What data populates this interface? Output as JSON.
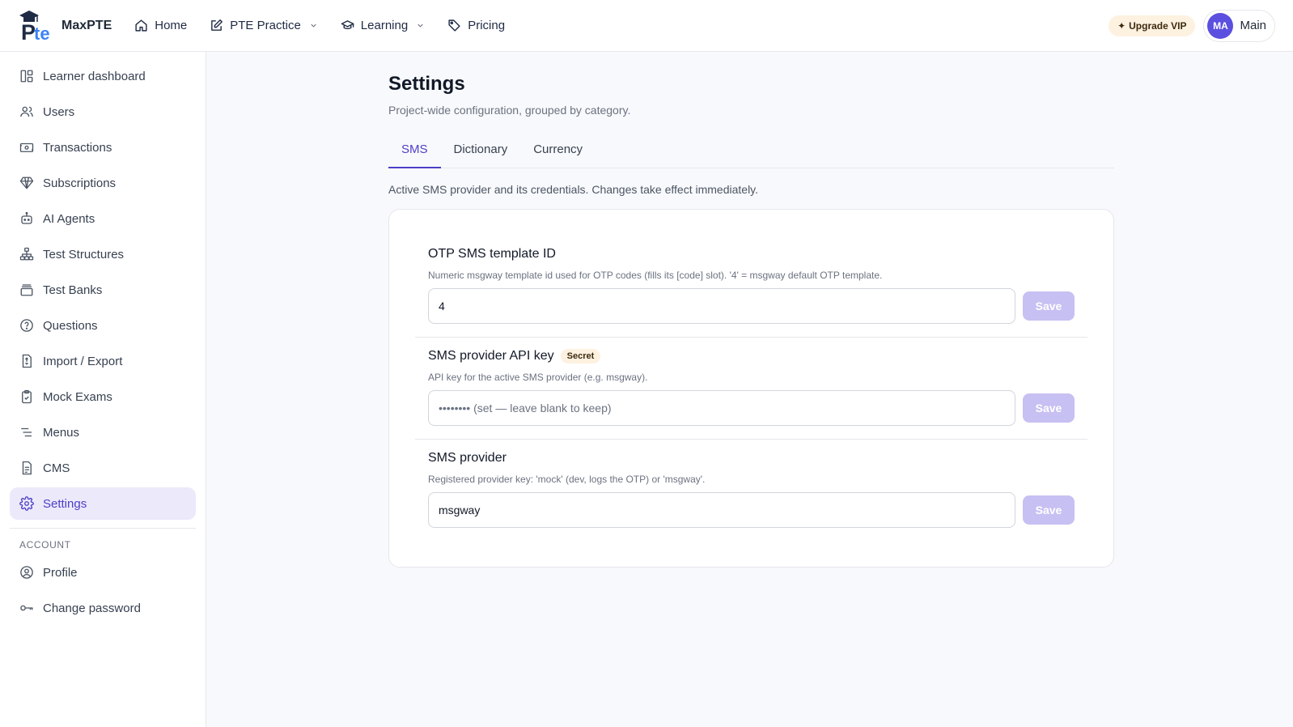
{
  "brand": {
    "name": "MaxPTE"
  },
  "nav": {
    "items": [
      {
        "label": "Home",
        "icon": "home-icon"
      },
      {
        "label": "PTE Practice",
        "icon": "pencil-square-icon",
        "has_dropdown": true
      },
      {
        "label": "Learning",
        "icon": "graduation-cap-icon",
        "has_dropdown": true
      },
      {
        "label": "Pricing",
        "icon": "tag-icon"
      }
    ]
  },
  "header": {
    "vip_label": "Upgrade VIP",
    "user_initials": "MA",
    "user_name": "Main"
  },
  "sidebar": {
    "items": [
      {
        "label": "Learner dashboard",
        "icon": "dashboard-icon"
      },
      {
        "label": "Users",
        "icon": "users-icon"
      },
      {
        "label": "Transactions",
        "icon": "banknote-icon"
      },
      {
        "label": "Subscriptions",
        "icon": "gem-icon"
      },
      {
        "label": "AI Agents",
        "icon": "bot-icon"
      },
      {
        "label": "Test Structures",
        "icon": "hierarchy-icon"
      },
      {
        "label": "Test Banks",
        "icon": "archive-icon"
      },
      {
        "label": "Questions",
        "icon": "question-circle-icon"
      },
      {
        "label": "Import / Export",
        "icon": "file-transfer-icon"
      },
      {
        "label": "Mock Exams",
        "icon": "clipboard-check-icon"
      },
      {
        "label": "Menus",
        "icon": "menu-lines-icon"
      },
      {
        "label": "CMS",
        "icon": "document-icon"
      },
      {
        "label": "Settings",
        "icon": "gear-icon",
        "active": true
      }
    ],
    "account_section": "ACCOUNT",
    "account_items": [
      {
        "label": "Profile",
        "icon": "user-circle-icon"
      },
      {
        "label": "Change password",
        "icon": "key-icon"
      }
    ]
  },
  "main": {
    "title": "Settings",
    "subtitle": "Project-wide configuration, grouped by category.",
    "tabs": [
      {
        "label": "SMS",
        "active": true
      },
      {
        "label": "Dictionary"
      },
      {
        "label": "Currency"
      }
    ],
    "tab_description": "Active SMS provider and its credentials. Changes take effect immediately.",
    "fields": [
      {
        "title": "OTP SMS template ID",
        "badge": "",
        "description": "Numeric msgway template id used for OTP codes (fills its [code] slot). '4' = msgway default OTP template.",
        "value": "4",
        "placeholder": "",
        "save_label": "Save"
      },
      {
        "title": "SMS provider API key",
        "badge": "Secret",
        "description": "API key for the active SMS provider (e.g. msgway).",
        "value": "",
        "placeholder": "•••••••• (set — leave blank to keep)",
        "save_label": "Save"
      },
      {
        "title": "SMS provider",
        "badge": "",
        "description": "Registered provider key: 'mock' (dev, logs the OTP) or 'msgway'.",
        "value": "msgway",
        "placeholder": "",
        "save_label": "Save"
      }
    ]
  },
  "colors": {
    "accent": "#4c3fc7",
    "accent_soft": "#ece9fb",
    "save_disabled": "#c7c0f3",
    "vip_bg": "#fdf1e0",
    "avatar_bg": "#5b4fe0"
  }
}
